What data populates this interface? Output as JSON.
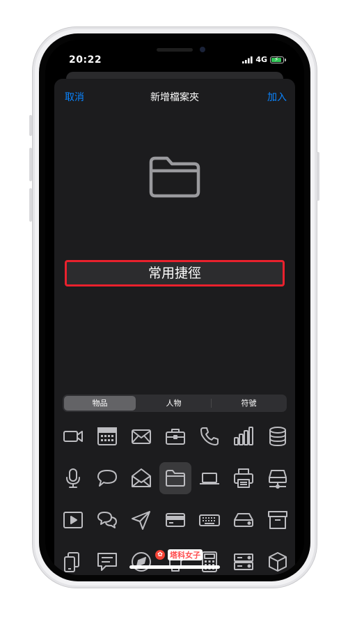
{
  "status": {
    "time": "20:22",
    "network": "4G"
  },
  "nav": {
    "cancel": "取消",
    "title": "新增檔案夾",
    "add": "加入"
  },
  "folder_name": {
    "value": "常用捷徑"
  },
  "segments": [
    "物品",
    "人物",
    "符號"
  ],
  "selected_segment": 0,
  "icons": [
    [
      "video-camera-icon",
      "calendar-icon",
      "mail-icon",
      "briefcase-icon",
      "phone-icon",
      "signal-bars-icon",
      "database-icon"
    ],
    [
      "microphone-icon",
      "speech-bubble-icon",
      "open-envelope-icon",
      "folder-icon",
      "laptop-icon",
      "printer-icon",
      "network-drive-icon"
    ],
    [
      "play-button-icon",
      "chat-bubbles-icon",
      "paper-plane-icon",
      "credit-card-icon",
      "keyboard-icon",
      "hard-drive-icon",
      "archive-box-icon"
    ],
    [
      "devices-icon",
      "message-box-icon",
      "compass-icon",
      "watch-icon",
      "calculator-icon",
      "server-icon",
      "cube-icon"
    ]
  ],
  "selected_icon": "folder-icon",
  "watermark": {
    "text": "塔科女子"
  },
  "colors": {
    "accent": "#0a84ff",
    "highlight": "#e9212d",
    "sheet": "#1c1c1e"
  }
}
